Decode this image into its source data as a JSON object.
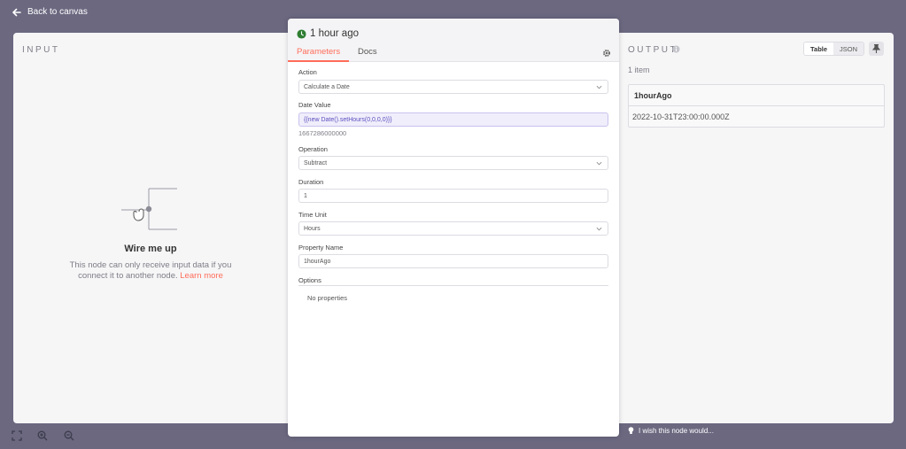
{
  "topbar": {
    "back_label": "Back to canvas"
  },
  "input_panel": {
    "title": "INPUT",
    "wire_title": "Wire me up",
    "wire_desc_line1": "This node can only receive input data if you",
    "wire_desc_line2": "connect it to another node.",
    "learn_more": "Learn more"
  },
  "node": {
    "title": "1 hour ago",
    "tabs": [
      "Parameters",
      "Docs"
    ],
    "fields": {
      "action_label": "Action",
      "action_value": "Calculate a Date",
      "date_label": "Date Value",
      "date_value": "{{new Date().setHours(0,0,0,0)}}",
      "date_hint": "1667286000000",
      "operation_label": "Operation",
      "operation_value": "Subtract",
      "duration_label": "Duration",
      "duration_value": "1",
      "unit_label": "Time Unit",
      "unit_value": "Hours",
      "property_label": "Property Name",
      "property_value": "1hourAgo",
      "options_label": "Options",
      "no_properties": "No properties"
    }
  },
  "output_panel": {
    "title": "OUTPUT",
    "toggle": [
      "Table",
      "JSON"
    ],
    "item_count": "1 item",
    "column": "1hourAgo",
    "value": "2022-10-31T23:00:00.000Z"
  },
  "footer": {
    "wish": "I wish this node would..."
  },
  "colors": {
    "accent": "#ff6d5a",
    "node_icon": "#2e7d32",
    "expression": "#5c4fbf"
  }
}
